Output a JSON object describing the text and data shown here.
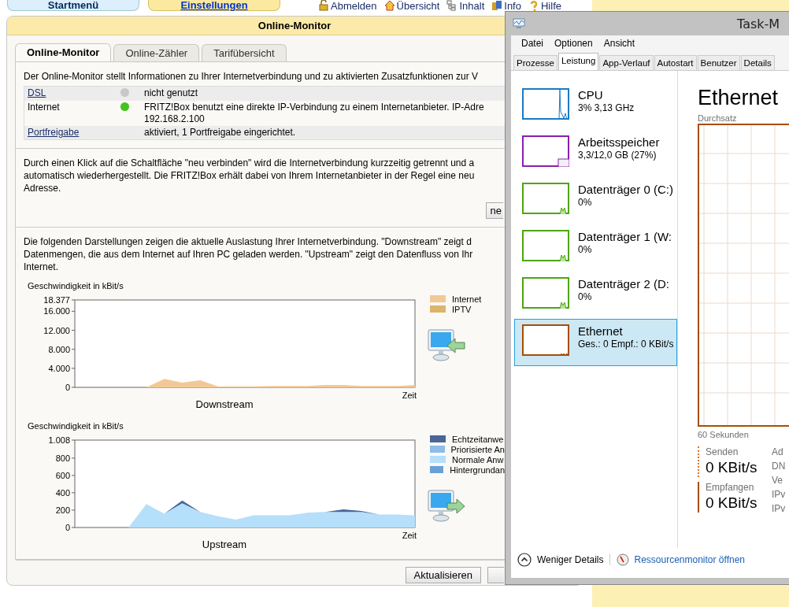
{
  "browser": {
    "top_tabs": [
      {
        "label": "Startmenü",
        "selected": false
      },
      {
        "label": "Einstellungen",
        "selected": true
      }
    ],
    "nav": [
      "Abmelden",
      "Übersicht",
      "Inhalt",
      "Info",
      "Hilfe"
    ],
    "panel": {
      "title": "Online-Monitor",
      "tabs": [
        {
          "label": "Online-Monitor",
          "selected": true
        },
        {
          "label": "Online-Zähler",
          "selected": false
        },
        {
          "label": "Tarifübersicht",
          "selected": false
        }
      ],
      "intro": "Der Online-Monitor stellt Informationen zu Ihrer Internetverbindung und zu aktivierten Zusatzfunktionen zur V",
      "status_rows": [
        {
          "name": "DSL",
          "link": true,
          "color": "#c8c8c8",
          "lines": [
            "nicht genutzt"
          ]
        },
        {
          "name": "Internet",
          "link": false,
          "color": "#44c21e",
          "lines": [
            "FRITZ!Box benutzt eine direkte IP-Verbindung zu einem Internetanbieter. IP-Adre",
            "192.168.2.100"
          ]
        },
        {
          "name": "Portfreigabe",
          "link": true,
          "lines": [
            "aktiviert, 1 Portfreigabe eingerichtet."
          ]
        }
      ],
      "reconnect_text": [
        "Durch einen Klick auf die Schaltfläche \"neu verbinden\" wird die Internetverbindung kurzzeitig getrennt und a",
        "automatisch wiederhergestellt. Die FRITZ!Box erhält dabei von Ihrem Internetanbieter in der Regel eine neu",
        "Adresse."
      ],
      "reconnect_button": "ne",
      "charts_text": [
        "Die folgenden Darstellungen zeigen die aktuelle Auslastung Ihrer Internetverbindung. \"Downstream\" zeigt d",
        "Datenmengen, die aus dem Internet auf Ihren PC geladen werden. \"Upstream\" zeigt den Datenfluss von Ihr",
        "Internet."
      ],
      "charts": [
        {
          "chart_data": {
            "type": "area",
            "title": "Downstream",
            "ylabel": "Geschwindigkeit in kBit/s",
            "xlabel": "Zeit",
            "stacked": true,
            "ylim": [
              0,
              18377
            ],
            "yticks": [
              {
                "value": 0,
                "label": "0"
              },
              {
                "value": 4000,
                "label": "4.000"
              },
              {
                "value": 8000,
                "label": "8.000"
              },
              {
                "value": 12000,
                "label": "12.000"
              },
              {
                "value": 16000,
                "label": "16.000"
              },
              {
                "value": 18377,
                "label": "18.377"
              }
            ],
            "series": [
              {
                "name": "Internet",
                "color": "#f2c994",
                "values": [
                  0,
                  0,
                  0,
                  0,
                  0,
                  1800,
                  1000,
                  1500,
                  200,
                  200,
                  200,
                  300,
                  300,
                  300,
                  500,
                  500,
                  300,
                  300,
                  300,
                  500
                ]
              },
              {
                "name": "IPTV",
                "color": "#deb46a",
                "values": [
                  null,
                  null,
                  null,
                  null,
                  null,
                  null,
                  null,
                  null,
                  null,
                  null,
                  null,
                  null,
                  null,
                  null,
                  null,
                  null,
                  null,
                  null,
                  null,
                  null
                ]
              }
            ]
          }
        },
        {
          "chart_data": {
            "type": "area",
            "title": "Upstream",
            "ylabel": "Geschwindigkeit in kBit/s",
            "xlabel": "Zeit",
            "stacked": true,
            "ylim": [
              0,
              1008
            ],
            "yticks": [
              {
                "value": 0,
                "label": "0"
              },
              {
                "value": 200,
                "label": "200"
              },
              {
                "value": 400,
                "label": "400"
              },
              {
                "value": 600,
                "label": "600"
              },
              {
                "value": 800,
                "label": "800"
              },
              {
                "value": 1008,
                "label": "1.008"
              }
            ],
            "series": [
              {
                "name": "Echtzeitanwe",
                "color": "#4a6699",
                "values": [
                  0,
                  0,
                  0,
                  0,
                  0,
                  0,
                  30,
                  0,
                  0,
                  0,
                  0,
                  0,
                  0,
                  0,
                  0,
                  30,
                  10,
                  0,
                  0,
                  0
                ]
              },
              {
                "name": "Priorisierte An",
                "color": "#8fbbe8",
                "values": [
                  null,
                  null,
                  null,
                  null,
                  null,
                  null,
                  null,
                  null,
                  null,
                  null,
                  null,
                  null,
                  null,
                  null,
                  null,
                  null,
                  null,
                  null,
                  null,
                  null
                ]
              },
              {
                "name": "Normale Anw",
                "color": "#b5dffa",
                "values": [
                  0,
                  0,
                  0,
                  0,
                  270,
                  160,
                  280,
                  180,
                  130,
                  90,
                  140,
                  140,
                  140,
                  170,
                  180,
                  180,
                  180,
                  150,
                  150,
                  140
                ]
              },
              {
                "name": "Hintergrundan",
                "color": "#6aa0d8",
                "values": [
                  null,
                  null,
                  null,
                  null,
                  null,
                  null,
                  null,
                  null,
                  null,
                  null,
                  null,
                  null,
                  null,
                  null,
                  null,
                  null,
                  null,
                  null,
                  null,
                  null
                ]
              }
            ]
          }
        }
      ],
      "buttons": [
        "Aktualisieren"
      ]
    }
  },
  "task_manager": {
    "title": "Task-M",
    "menu": [
      "Datei",
      "Optionen",
      "Ansicht"
    ],
    "tabs": [
      {
        "label": "Prozesse",
        "selected": false
      },
      {
        "label": "Leistung",
        "selected": true
      },
      {
        "label": "App-Verlauf",
        "selected": false
      },
      {
        "label": "Autostart",
        "selected": false
      },
      {
        "label": "Benutzer",
        "selected": false
      },
      {
        "label": "Details",
        "selected": false
      }
    ],
    "resources": [
      {
        "name": "CPU",
        "detail": "3% 3,13 GHz",
        "color": "#1c7ac4",
        "selected": false
      },
      {
        "name": "Arbeitsspeicher",
        "detail": "3,3/12,0 GB (27%)",
        "color": "#8b1fae",
        "selected": false
      },
      {
        "name": "Datenträger 0 (C:)",
        "detail": "0%",
        "color": "#4da60c",
        "selected": false
      },
      {
        "name": "Datenträger 1 (W:",
        "detail": "0%",
        "color": "#4da60c",
        "selected": false
      },
      {
        "name": "Datenträger 2 (D:",
        "detail": "0%",
        "color": "#4da60c",
        "selected": false
      },
      {
        "name": "Ethernet",
        "detail": "Ges.: 0 Empf.: 0 KBit/s",
        "color": "#a74f01",
        "selected": true
      }
    ],
    "detail": {
      "heading": "Ethernet",
      "graph_label": "Durchsatz",
      "time_label": "60 Sekunden",
      "stats": [
        {
          "label": "Senden",
          "value": "0 KBit/s",
          "kind": "dotted"
        },
        {
          "label": "Empfangen",
          "value": "0 KBit/s",
          "kind": "solid"
        }
      ],
      "side_labels": [
        "Ad",
        "DN",
        "Ve",
        "IPv",
        "IPv"
      ]
    },
    "footer": {
      "toggle": "Weniger Details",
      "link": "Ressourcenmonitor öffnen"
    }
  }
}
